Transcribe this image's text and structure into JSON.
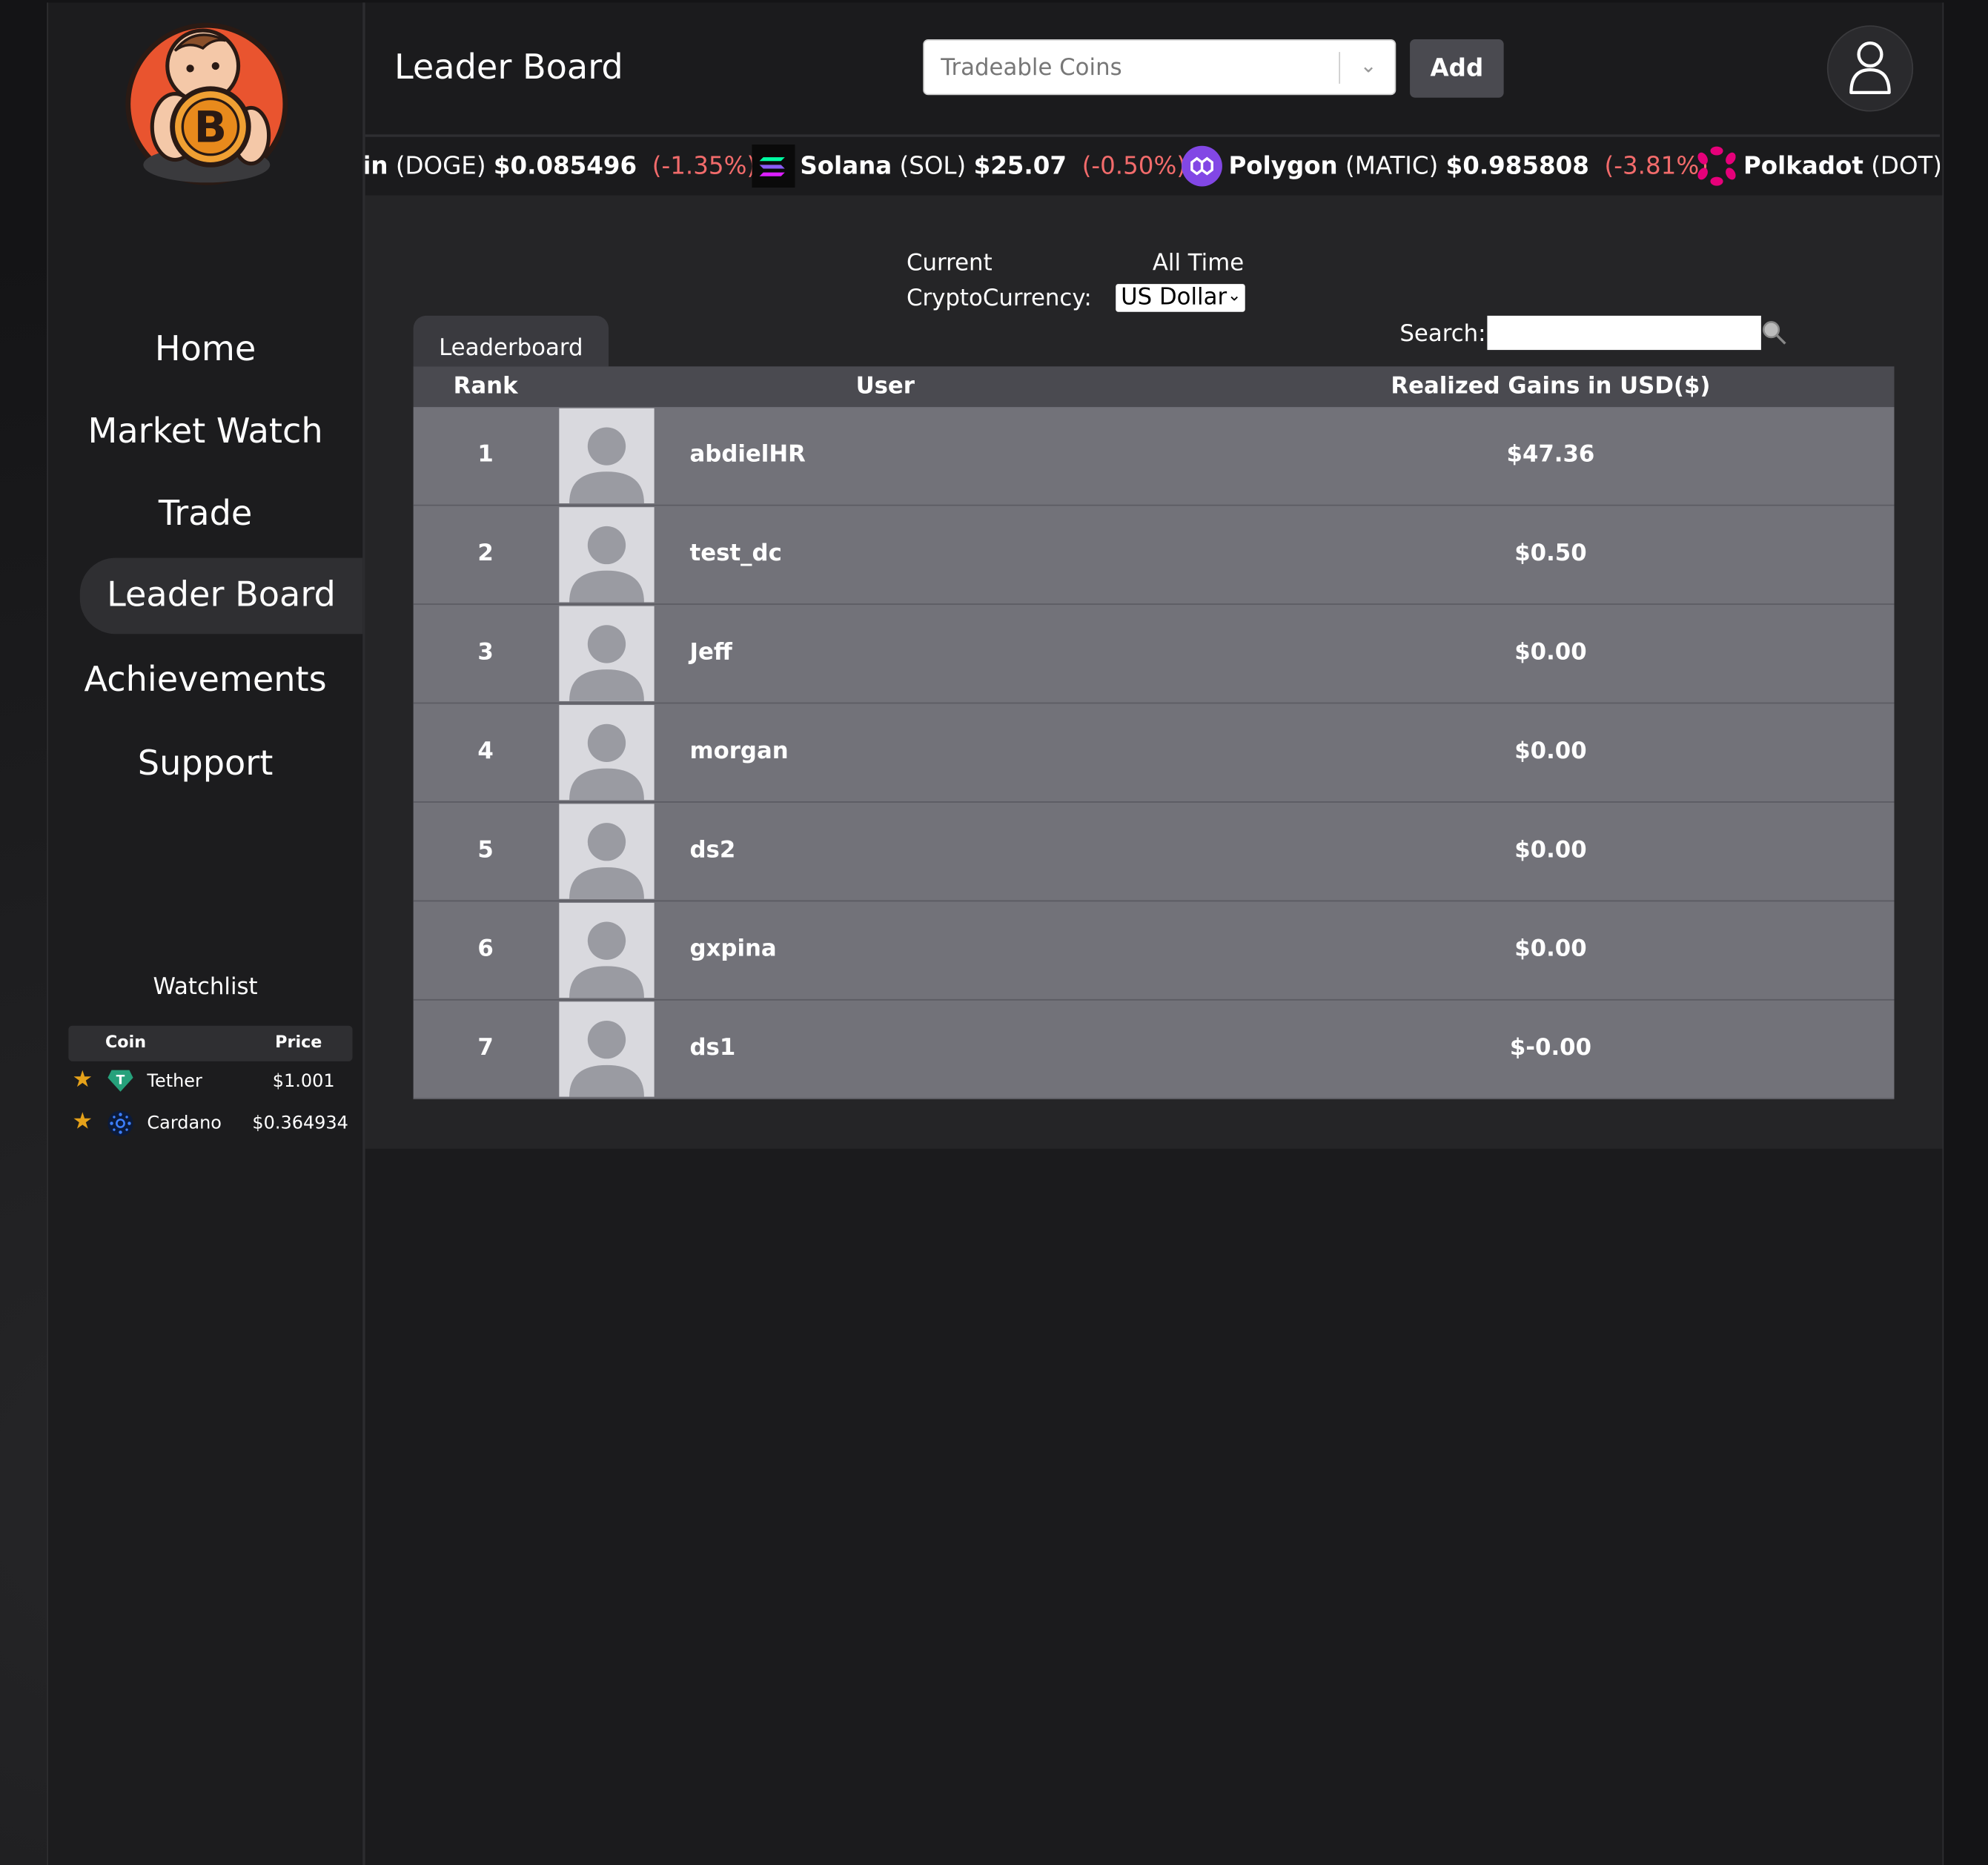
{
  "header": {
    "title": "Leader Board",
    "coin_select_placeholder": "Tradeable Coins",
    "add_label": "Add"
  },
  "ticker": [
    {
      "name": "in",
      "symbol": "(DOGE)",
      "price": "$0.085496",
      "change": "(-1.35%)",
      "icon": "dogecoin-icon"
    },
    {
      "name": "Solana",
      "symbol": "(SOL)",
      "price": "$25.07",
      "change": "(-0.50%)",
      "icon": "solana-icon"
    },
    {
      "name": "Polygon",
      "symbol": "(MATIC)",
      "price": "$0.985808",
      "change": "(-3.81%)",
      "icon": "polygon-icon"
    },
    {
      "name": "Polkadot",
      "symbol": "(DOT)",
      "price": "$(",
      "change": "",
      "icon": "polkadot-icon"
    }
  ],
  "sidebar": {
    "nav": [
      {
        "label": "Home"
      },
      {
        "label": "Market Watch"
      },
      {
        "label": "Trade"
      },
      {
        "label": "Leader Board"
      },
      {
        "label": "Achievements"
      },
      {
        "label": "Support"
      }
    ],
    "watchlist": {
      "title": "Watchlist",
      "headers": {
        "coin": "Coin",
        "price": "Price"
      },
      "rows": [
        {
          "coin": "Tether",
          "price": "$1.001",
          "icon": "tether-icon"
        },
        {
          "coin": "Cardano",
          "price": "$0.364934",
          "icon": "cardano-icon"
        }
      ]
    }
  },
  "panel": {
    "current_label": "Current",
    "all_time_label": "All Time",
    "crypto_label": "CryptoCurrency:",
    "currency_value": "US Dollar",
    "search_label": "Search:",
    "tab_label": "Leaderboard",
    "columns": {
      "rank": "Rank",
      "user": "User",
      "gains": "Realized Gains in USD($)"
    },
    "rows": [
      {
        "rank": "1",
        "user": "abdielHR",
        "gain": "$47.36"
      },
      {
        "rank": "2",
        "user": "test_dc",
        "gain": "$0.50"
      },
      {
        "rank": "3",
        "user": "Jeff",
        "gain": "$0.00"
      },
      {
        "rank": "4",
        "user": "morgan",
        "gain": "$0.00"
      },
      {
        "rank": "5",
        "user": "ds2",
        "gain": "$0.00"
      },
      {
        "rank": "6",
        "user": "gxpina",
        "gain": "$0.00"
      },
      {
        "rank": "7",
        "user": "ds1",
        "gain": "$-0.00"
      }
    ]
  },
  "colors": {
    "negative": "#f26b6b",
    "star": "#e6a21a",
    "row_bg": "#727279",
    "header_bg": "#4a4a50"
  }
}
